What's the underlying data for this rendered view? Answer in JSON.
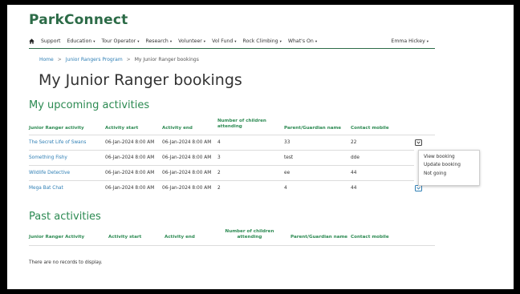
{
  "brand": "ParkConnect",
  "nav": {
    "items": [
      {
        "label": "Support",
        "dropdown": false
      },
      {
        "label": "Education",
        "dropdown": true
      },
      {
        "label": "Tour Operator",
        "dropdown": true
      },
      {
        "label": "Research",
        "dropdown": true
      },
      {
        "label": "Volunteer",
        "dropdown": true
      },
      {
        "label": "Vol Fund",
        "dropdown": true
      },
      {
        "label": "Rock Climbing",
        "dropdown": true
      },
      {
        "label": "What's On",
        "dropdown": true
      }
    ],
    "user": "Emma Hickey",
    "caret": "▾"
  },
  "breadcrumb": {
    "home": "Home",
    "program": "Junior Rangers Program",
    "current": "My Junior Ranger bookings",
    "sep": ">"
  },
  "page_title": "My Junior Ranger bookings",
  "upcoming": {
    "title": "My upcoming activities",
    "headers": [
      "Junior Ranger activity",
      "Activity start",
      "Activity end",
      "Number of children attending",
      "Parent/Guardian name",
      "Contact mobile"
    ],
    "rows": [
      {
        "activity": "The Secret Life of Swans",
        "start": "06-Jan-2024 8:00 AM",
        "end": "06-Jan-2024 8:00 AM",
        "children": "4",
        "guardian": "33",
        "mobile": "22"
      },
      {
        "activity": "Something Fishy",
        "start": "06-Jan-2024 8:00 AM",
        "end": "06-Jan-2024 8:00 AM",
        "children": "3",
        "guardian": "test",
        "mobile": "dde"
      },
      {
        "activity": "Wildlife Detective",
        "start": "06-Jan-2024 8:00 AM",
        "end": "06-Jan-2024 8:00 AM",
        "children": "2",
        "guardian": "ee",
        "mobile": "44"
      },
      {
        "activity": "Mega Bat Chat",
        "start": "06-Jan-2024 8:00 AM",
        "end": "06-Jan-2024 8:00 AM",
        "children": "2",
        "guardian": "4",
        "mobile": "44"
      }
    ],
    "menu": [
      "View booking",
      "Update booking",
      "Not going"
    ]
  },
  "past": {
    "title": "Past activities",
    "headers": [
      "Junior Ranger Activity",
      "Activity start",
      "Activity end",
      "Number of children attending",
      "Parent/Guardian name",
      "Contact mobile"
    ],
    "empty_text": "There are no records to display."
  },
  "colors": {
    "brand_green": "#2c6b47",
    "heading_green": "#2c8a52",
    "link_blue": "#2f7fb5"
  }
}
